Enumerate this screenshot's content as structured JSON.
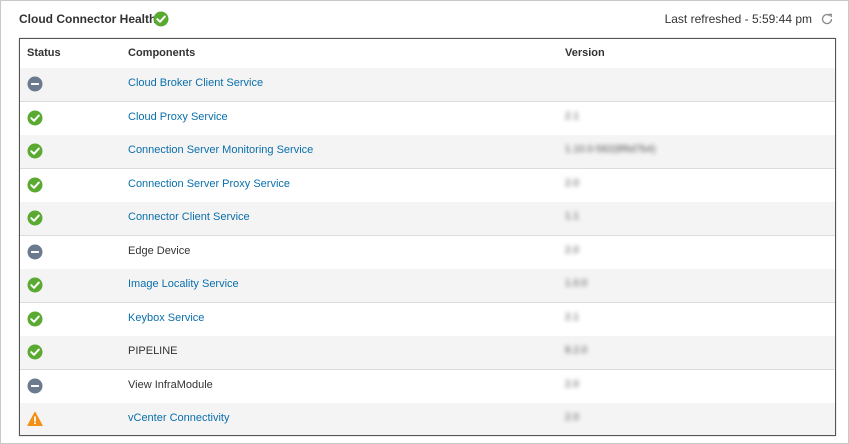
{
  "header": {
    "title": "Cloud Connector Health",
    "title_status": "ok",
    "last_refreshed": "Last refreshed - 5:59:44 pm",
    "refresh_icon": "refresh-icon"
  },
  "table": {
    "columns": [
      "Status",
      "Components",
      "Version"
    ],
    "rows": [
      {
        "status": "disabled",
        "component": "Cloud Broker Client Service",
        "link": true,
        "version": ""
      },
      {
        "status": "ok",
        "component": "Cloud Proxy Service",
        "link": true,
        "version": "2.1"
      },
      {
        "status": "ok",
        "component": "Connection Server Monitoring Service",
        "link": true,
        "version": "1.10.0-582(8f6d7b4)"
      },
      {
        "status": "ok",
        "component": "Connection Server Proxy Service",
        "link": true,
        "version": "2.0"
      },
      {
        "status": "ok",
        "component": "Connector Client Service",
        "link": true,
        "version": "1.1"
      },
      {
        "status": "disabled",
        "component": "Edge Device",
        "link": false,
        "version": "2.0"
      },
      {
        "status": "ok",
        "component": "Image Locality Service",
        "link": true,
        "version": "1.0.0"
      },
      {
        "status": "ok",
        "component": "Keybox Service",
        "link": true,
        "version": "2.1"
      },
      {
        "status": "ok",
        "component": "PIPELINE",
        "link": false,
        "version": "8.2.0"
      },
      {
        "status": "disabled",
        "component": "View InfraModule",
        "link": false,
        "version": "2.0"
      },
      {
        "status": "warning",
        "component": "vCenter Connectivity",
        "link": true,
        "version": "2.0"
      }
    ]
  },
  "colors": {
    "ok": "#5aaa32",
    "disabled": "#6b7a8c",
    "warning": "#f29016",
    "link": "#0a6fab"
  }
}
